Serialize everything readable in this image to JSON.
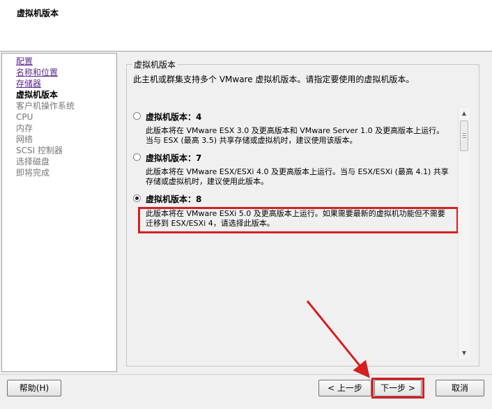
{
  "header": {
    "title": "虚拟机版本"
  },
  "nav": {
    "items": [
      {
        "label": "配置",
        "state": "done"
      },
      {
        "label": "名称和位置",
        "state": "done"
      },
      {
        "label": "存储器",
        "state": "done"
      },
      {
        "label": "虚拟机版本",
        "state": "current"
      },
      {
        "label": "客户机操作系统",
        "state": "pending"
      },
      {
        "label": "CPU",
        "state": "pending"
      },
      {
        "label": "内存",
        "state": "pending"
      },
      {
        "label": "网络",
        "state": "pending"
      },
      {
        "label": "SCSI 控制器",
        "state": "pending"
      },
      {
        "label": "选择磁盘",
        "state": "pending"
      },
      {
        "label": "即将完成",
        "state": "pending"
      }
    ]
  },
  "main": {
    "group_title": "虚拟机版本",
    "description": "此主机或群集支持多个 VMware 虚拟机版本。请指定要使用的虚拟机版本。",
    "options": [
      {
        "label": "虚拟机版本：4",
        "selected": false,
        "desc": "此版本将在 VMware ESX 3.0 及更高版本和 VMware Server 1.0 及更高版本上运行。当与 ESX (最高 3.5) 共享存储或虚拟机时，建议使用该版本。"
      },
      {
        "label": "虚拟机版本：7",
        "selected": false,
        "desc": "此版本将在 VMware ESX/ESXi 4.0 及更高版本上运行。当与 ESX/ESXi (最高 4.1) 共享存储或虚拟机时，建议使用此版本。"
      },
      {
        "label": "虚拟机版本：8",
        "selected": true,
        "desc": "此版本将在 VMware ESXi 5.0 及更高版本上运行。如果需要最新的虚拟机功能但不需要迁移到 ESX/ESXi 4，请选择此版本。"
      }
    ]
  },
  "footer": {
    "help_label": "帮助(H)",
    "back_label": "< 上一步",
    "next_label": "下一步 >",
    "cancel_label": "取消"
  },
  "colors": {
    "annotation_red": "#d42020",
    "visited_link": "#5b2a8c"
  }
}
